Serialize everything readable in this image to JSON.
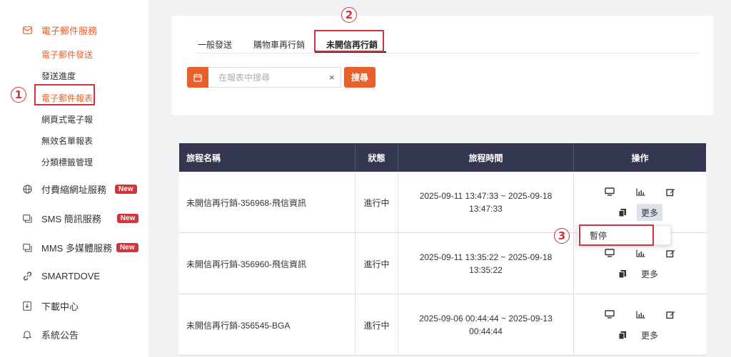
{
  "sidebar": {
    "groups": [
      {
        "label": "電子郵件服務",
        "icon": "envelope-icon"
      },
      {
        "label": "付費縮網址服務",
        "icon": "globe-icon",
        "badge": "New"
      },
      {
        "label": "SMS 簡訊服務",
        "icon": "chat-icon",
        "badge": "New"
      },
      {
        "label": "MMS 多媒體服務",
        "icon": "chat-icon",
        "badge": "New"
      },
      {
        "label": "SMARTDOVE",
        "icon": "link-icon"
      },
      {
        "label": "下載中心",
        "icon": "download-icon"
      },
      {
        "label": "系統公告",
        "icon": "bell-icon"
      }
    ],
    "email_items": [
      {
        "label": "電子郵件發送"
      },
      {
        "label": "發送進度"
      },
      {
        "label": "電子郵件報表"
      },
      {
        "label": "網頁式電子報"
      },
      {
        "label": "無效名單報表"
      },
      {
        "label": "分類標籤管理"
      }
    ]
  },
  "tabs": [
    {
      "label": "一般發送"
    },
    {
      "label": "購物車再行銷"
    },
    {
      "label": "未開信再行銷"
    }
  ],
  "search": {
    "placeholder": "在報表中搜尋",
    "clear": "×",
    "button": "搜尋"
  },
  "table": {
    "headers": {
      "name": "旅程名稱",
      "status": "狀態",
      "time": "旅程時間",
      "ops": "操作"
    },
    "rows": [
      {
        "name": "未開信再行銷-356968-飛信資訊",
        "status": "進行中",
        "time_line1": "2025-09-11 13:47:33 ~ 2025-09-18",
        "time_line2": "13:47:33",
        "more": "更多"
      },
      {
        "name": "未開信再行銷-356960-飛信資訊",
        "status": "進行中",
        "time_line1": "2025-09-11 13:35:22 ~ 2025-09-18",
        "time_line2": "13:35:22",
        "more": "更多"
      },
      {
        "name": "未開信再行銷-356545-BGA",
        "status": "進行中",
        "time_line1": "2025-09-06 00:44:44 ~ 2025-09-13",
        "time_line2": "00:44:44",
        "more": "更多"
      }
    ]
  },
  "dropdown": {
    "item": "暫停"
  },
  "annotations": [
    "1",
    "2",
    "3"
  ],
  "colors": {
    "accent": "#e8612c",
    "annotation": "#d0343c",
    "header_bg": "#333750",
    "badge": "#d0343c"
  }
}
